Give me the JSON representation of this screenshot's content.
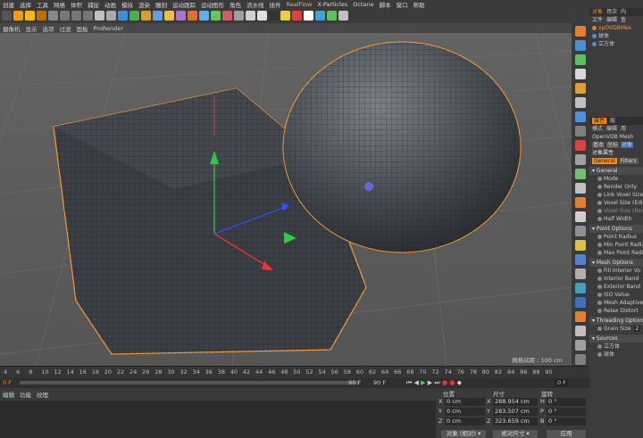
{
  "menubar": [
    "创建",
    "选择",
    "工具",
    "网格",
    "体积",
    "捕捉",
    "动画",
    "模拟",
    "渲染",
    "雕刻",
    "运动跟踪",
    "运动图形",
    "角色",
    "流水线",
    "插件",
    "RealFlow",
    "X-Particles",
    "Octane",
    "脚本",
    "窗口",
    "帮助"
  ],
  "viewport_menu": [
    "摄像机",
    "显示",
    "选项",
    "过滤",
    "面板",
    "ProRender"
  ],
  "grid_spacing": "网格间距 : 100 cm",
  "timeline": {
    "ticks": [
      "4",
      "6",
      "8",
      "10",
      "12",
      "14",
      "16",
      "18",
      "20",
      "22",
      "24",
      "26",
      "28",
      "30",
      "32",
      "34",
      "36",
      "38",
      "40",
      "42",
      "44",
      "46",
      "48",
      "50",
      "52",
      "54",
      "56",
      "58",
      "60",
      "62",
      "64",
      "66",
      "68",
      "70",
      "72",
      "74",
      "76",
      "78",
      "80",
      "82",
      "84",
      "86",
      "88",
      "90"
    ],
    "start_frame": "0 F",
    "end_frame": "90 F",
    "end_frame2": "90 F",
    "current_frame": "0 F"
  },
  "bottom_menu": [
    "编辑",
    "功能",
    "纹理"
  ],
  "coords": {
    "headers": {
      "position": "位置",
      "size": "尺寸",
      "rotation": "旋转"
    },
    "rows": [
      {
        "axis": "X",
        "pos": "0 cm",
        "size": "288.954 cm",
        "rot_label": "H",
        "rot": "0 °"
      },
      {
        "axis": "Y",
        "pos": "0 cm",
        "size": "283.507 cm",
        "rot_label": "P",
        "rot": "0 °"
      },
      {
        "axis": "Z",
        "pos": "0 cm",
        "size": "323.659 cm",
        "rot_label": "B",
        "rot": "0 °"
      }
    ],
    "mode_dropdown": "对象 (相对)",
    "size_dropdown": "绝对尺寸",
    "apply_button": "应用"
  },
  "right_panel": {
    "tabs": [
      "对象",
      "场次",
      "内"
    ],
    "object_menu": [
      "文件",
      "编辑",
      "查"
    ],
    "objects": [
      "xpOVDBMes",
      "球体",
      "立方体"
    ],
    "attr_tabs": [
      "属性",
      "层"
    ],
    "attr_menu": [
      "模式",
      "编辑",
      "用"
    ],
    "object_name": "OpenVDB Mesh",
    "sub_tabs": [
      "基本",
      "坐标",
      "对象"
    ],
    "section_title": "对象属性",
    "general_tabs": [
      "General",
      "Filters"
    ],
    "groups": [
      {
        "title": "General",
        "items": [
          {
            "label": "Mode",
            "dim": false
          },
          {
            "label": "Render Only",
            "dim": false
          },
          {
            "label": "Link Voxel Size",
            "dim": false
          },
          {
            "label": "Voxel Size (Edit)",
            "dim": false
          },
          {
            "label": "Voxel Size (Render)",
            "dim": true
          },
          {
            "label": "Half Width",
            "dim": false
          }
        ]
      },
      {
        "title": "Point Options",
        "items": [
          {
            "label": "Point Radius",
            "dim": false
          },
          {
            "label": "Min Point Radius",
            "dim": false
          },
          {
            "label": "Max Point Radius",
            "dim": false
          }
        ]
      },
      {
        "title": "Mesh Options",
        "items": [
          {
            "label": "Fill Interior Vo",
            "dim": false
          },
          {
            "label": "Interior Band",
            "dim": false
          },
          {
            "label": "Exterior Band",
            "dim": false
          },
          {
            "label": "ISO Value",
            "dim": false
          },
          {
            "label": "Mesh Adaptive",
            "dim": false
          },
          {
            "label": "Relax Distort",
            "dim": false
          }
        ]
      },
      {
        "title": "Threading Options",
        "items": [
          {
            "label": "Grain Size",
            "value": "2",
            "dim": false
          }
        ]
      },
      {
        "title": "Sources",
        "items": [
          {
            "label": "立方体",
            "dim": false
          },
          {
            "label": "球体",
            "dim": false
          }
        ]
      }
    ]
  },
  "colors": {
    "accent": "#ff8a00",
    "viewport_bg": "#5a5a5a",
    "mesh": "#3d4148",
    "selection": "#ff9d2e"
  }
}
